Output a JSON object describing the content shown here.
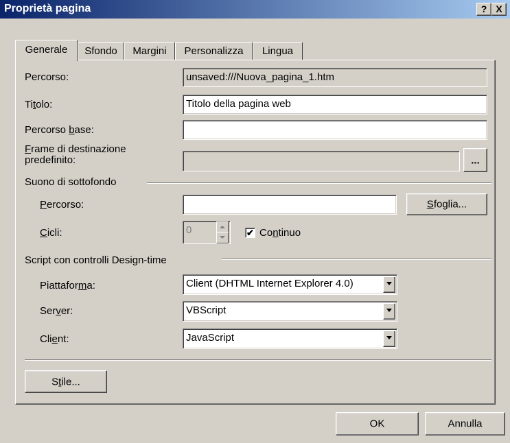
{
  "window": {
    "title": "Proprietà pagina",
    "help_label": "?",
    "close_label": "X"
  },
  "tabs": [
    {
      "label": "Generale",
      "active": true
    },
    {
      "label": "Sfondo",
      "active": false
    },
    {
      "label": "Margini",
      "active": false
    },
    {
      "label": "Personalizza",
      "active": false
    },
    {
      "label": "Lingua",
      "active": false
    }
  ],
  "general": {
    "path_label": "Percorso:",
    "path_value": "unsaved:///Nuova_pagina_1.htm",
    "title_label_pre": "Ti",
    "title_label_u": "t",
    "title_label_post": "olo:",
    "title_value": "Titolo della pagina web",
    "base_label_pre": "Percorso ",
    "base_label_u": "b",
    "base_label_post": "ase:",
    "base_value": "",
    "frame_label_u": "F",
    "frame_label_post": "rame di destinazione",
    "frame_label_line2": "predefinito:",
    "frame_value": "",
    "frame_button": "..."
  },
  "sound": {
    "group_label": "Suono di sottofondo",
    "path_label_u": "P",
    "path_label_post": "ercorso:",
    "path_value": "",
    "browse_u": "S",
    "browse_post": "foglia...",
    "loops_label_u": "C",
    "loops_label_post": "icli:",
    "loops_value": "0",
    "continuous_label_pre": "Co",
    "continuous_label_u": "n",
    "continuous_label_post": "tinuo",
    "continuous_checked": true,
    "check_glyph": "✔"
  },
  "script": {
    "group_label": "Script con controlli Design-time",
    "platform_label_pre": "Piattafor",
    "platform_label_u": "m",
    "platform_label_post": "a:",
    "platform_value": "Client (DHTML Internet Explorer 4.0)",
    "server_label_pre": "Ser",
    "server_label_u": "v",
    "server_label_post": "er:",
    "server_value": "VBScript",
    "client_label_pre": "Cli",
    "client_label_u": "e",
    "client_label_post": "nt:",
    "client_value": "JavaScript"
  },
  "style_button": {
    "pre": "S",
    "u": "t",
    "post": "ile..."
  },
  "footer": {
    "ok_label": "OK",
    "cancel_label": "Annulla"
  }
}
